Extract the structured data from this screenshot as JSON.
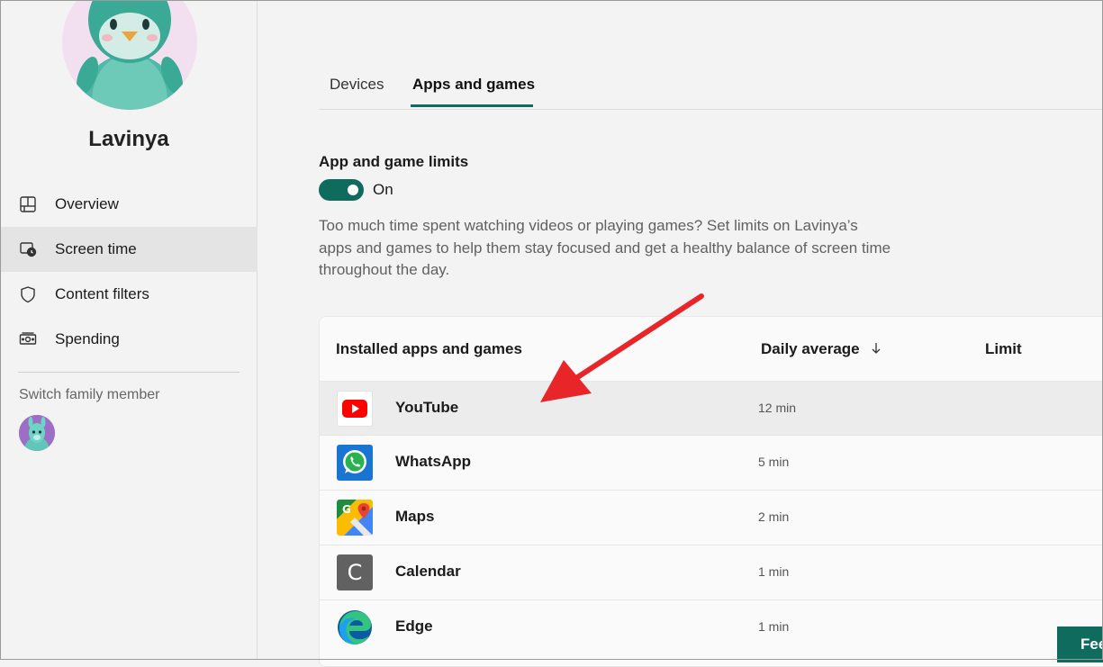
{
  "profile": {
    "name": "Lavinya"
  },
  "sidebar": {
    "items": [
      {
        "label": "Overview",
        "icon": "overview-icon"
      },
      {
        "label": "Screen time",
        "icon": "screen-time-icon",
        "active": true
      },
      {
        "label": "Content filters",
        "icon": "shield-icon"
      },
      {
        "label": "Spending",
        "icon": "money-icon"
      }
    ],
    "switch_label": "Switch family member"
  },
  "tabs": [
    {
      "label": "Devices"
    },
    {
      "label": "Apps and games",
      "active": true
    }
  ],
  "limits": {
    "title": "App and game limits",
    "toggle_state": "On",
    "enabled": true,
    "description": "Too much time spent watching videos or playing games? Set limits on Lavinya’s apps and games to help them stay focused and get a healthy balance of screen time throughout the day."
  },
  "table": {
    "headers": {
      "name": "Installed apps and games",
      "daily": "Daily average",
      "sort_icon": "arrow-down-icon",
      "limit": "Limit"
    },
    "rows": [
      {
        "name": "YouTube",
        "time": "12 min",
        "icon": "youtube-icon"
      },
      {
        "name": "WhatsApp",
        "time": "5 min",
        "icon": "whatsapp-icon"
      },
      {
        "name": "Maps",
        "time": "2 min",
        "icon": "maps-icon"
      },
      {
        "name": "Calendar",
        "time": "1 min",
        "icon": "calendar-icon",
        "letter": "C"
      },
      {
        "name": "Edge",
        "time": "1 min",
        "icon": "edge-icon"
      }
    ]
  },
  "feedback": {
    "label": "Fee"
  },
  "colors": {
    "accent": "#0f6b5e",
    "annotation_arrow": "#e8262a"
  }
}
